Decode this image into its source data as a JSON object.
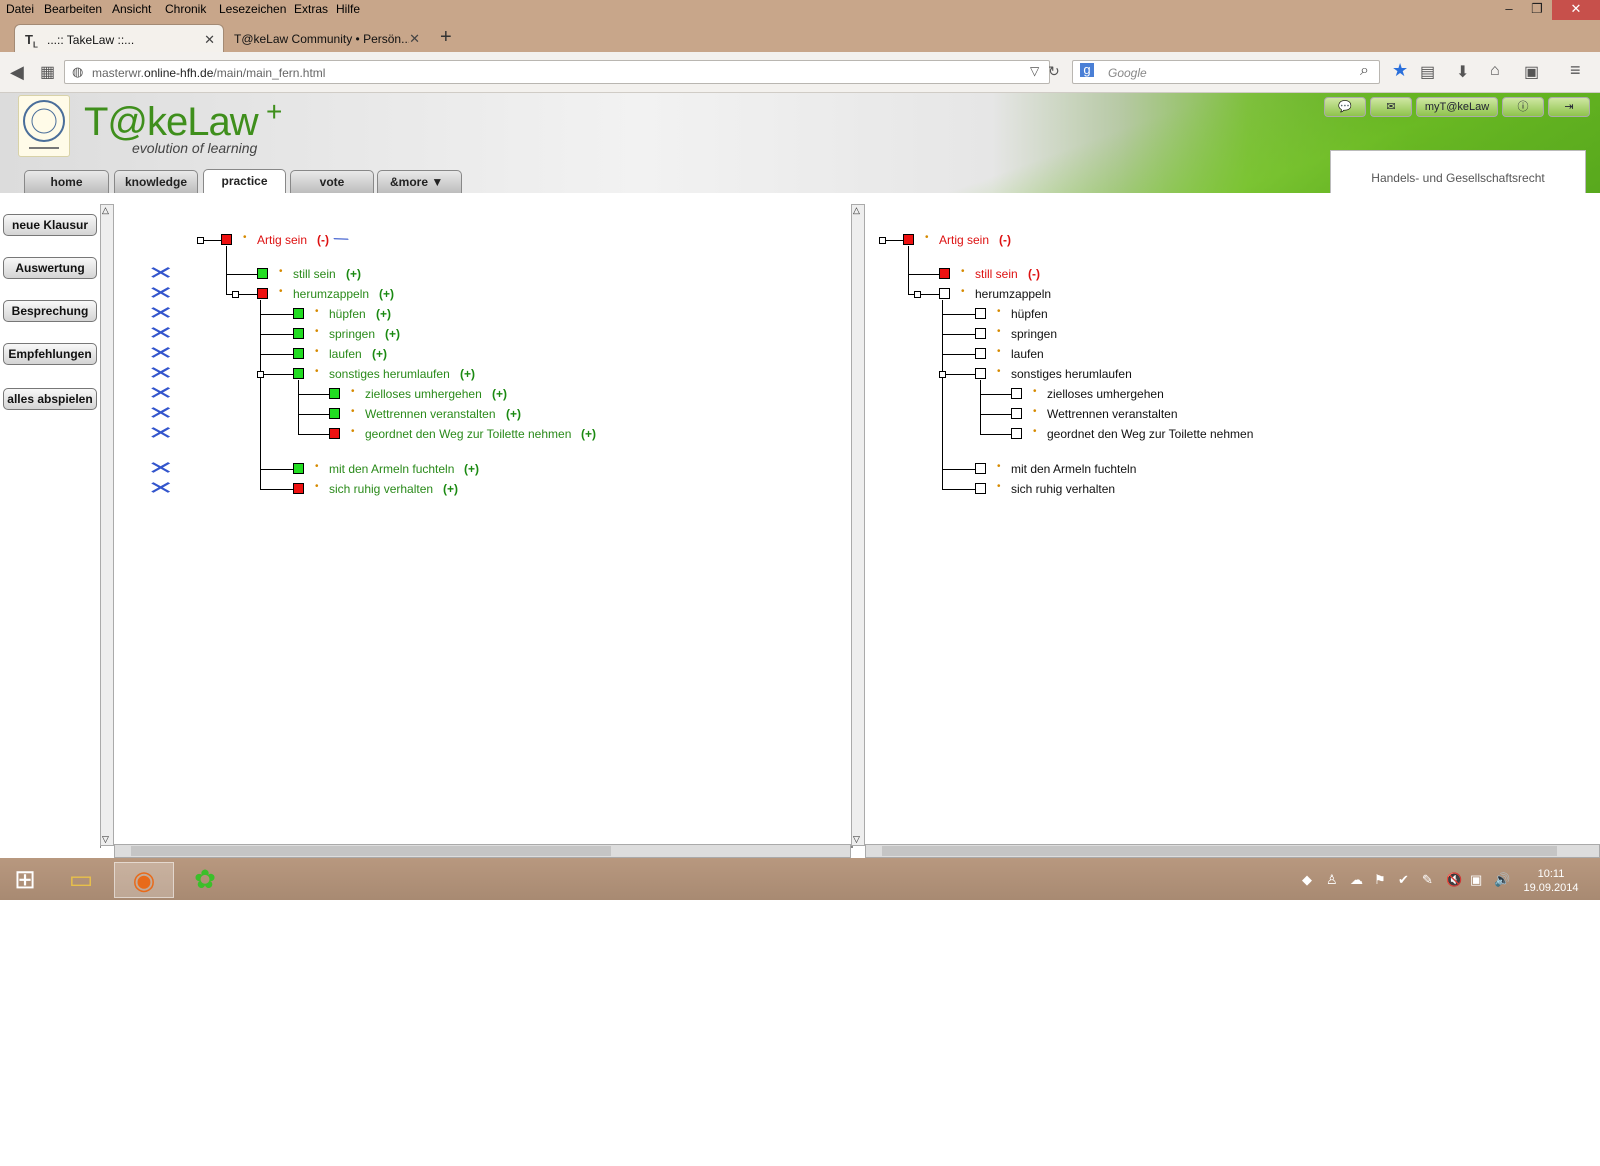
{
  "menu": [
    "Datei",
    "Bearbeiten",
    "Ansicht",
    "Chronik",
    "Lesezeichen",
    "Extras",
    "Hilfe"
  ],
  "tabs": [
    {
      "title": "...:: TakeLaw ::..."
    },
    {
      "title": "T@keLaw Community • Persön..."
    }
  ],
  "address": {
    "host_pre": "masterwr.",
    "host": "online-hfh.de",
    "path": "/main/main_fern.html"
  },
  "search": {
    "placeholder": "Google"
  },
  "site": {
    "logo": "T@keLaw",
    "logo_plus": "+",
    "slogan": "evolution of learning",
    "nav": [
      "home",
      "knowledge",
      "practice",
      "vote",
      "&more"
    ],
    "active_nav": "practice",
    "header_buttons": [
      "myT@keLaw"
    ],
    "course": "Handels- und Gesellschaftsrecht"
  },
  "sidebar": [
    "neue Klausur",
    "Auswertung",
    "Besprechung",
    "Empfehlungen",
    "alles abspielen"
  ],
  "tree_left": [
    {
      "label": "Artig sein",
      "mark": "(-)",
      "box": "red",
      "label_color": "red",
      "mark_color": "red"
    },
    {
      "label": "still sein",
      "mark": "(+)",
      "box": "green",
      "label_color": "green",
      "mark_color": "green"
    },
    {
      "label": "herumzappeln",
      "mark": "(+)",
      "box": "red",
      "label_color": "green",
      "mark_color": "green"
    },
    {
      "label": "hüpfen",
      "mark": "(+)",
      "box": "green",
      "label_color": "green",
      "mark_color": "green"
    },
    {
      "label": "springen",
      "mark": "(+)",
      "box": "green",
      "label_color": "green",
      "mark_color": "green"
    },
    {
      "label": "laufen",
      "mark": "(+)",
      "box": "green",
      "label_color": "green",
      "mark_color": "green"
    },
    {
      "label": "sonstiges herumlaufen",
      "mark": "(+)",
      "box": "green",
      "label_color": "green",
      "mark_color": "green"
    },
    {
      "label": "zielloses umhergehen",
      "mark": "(+)",
      "box": "green",
      "label_color": "green",
      "mark_color": "green"
    },
    {
      "label": "Wettrennen veranstalten",
      "mark": "(+)",
      "box": "green",
      "label_color": "green",
      "mark_color": "green"
    },
    {
      "label": "geordnet den Weg zur Toilette nehmen",
      "mark": "(+)",
      "box": "red",
      "label_color": "green",
      "mark_color": "green"
    },
    {
      "label": "mit den Armeln fuchteln",
      "mark": "(+)",
      "box": "green",
      "label_color": "green",
      "mark_color": "green"
    },
    {
      "label": "sich ruhig verhalten",
      "mark": "(+)",
      "box": "red",
      "label_color": "green",
      "mark_color": "green"
    }
  ],
  "tree_right": [
    {
      "label": "Artig sein",
      "mark": "(-)",
      "box": "red",
      "label_color": "red",
      "mark_color": "red"
    },
    {
      "label": "still sein",
      "mark": "(-)",
      "box": "red",
      "label_color": "red",
      "mark_color": "red"
    },
    {
      "label": "herumzappeln",
      "mark": "",
      "box": "white",
      "label_color": "black",
      "mark_color": "black"
    },
    {
      "label": "hüpfen",
      "mark": "",
      "box": "white",
      "label_color": "black",
      "mark_color": "black"
    },
    {
      "label": "springen",
      "mark": "",
      "box": "white",
      "label_color": "black",
      "mark_color": "black"
    },
    {
      "label": "laufen",
      "mark": "",
      "box": "white",
      "label_color": "black",
      "mark_color": "black"
    },
    {
      "label": "sonstiges herumlaufen",
      "mark": "",
      "box": "white",
      "label_color": "black",
      "mark_color": "black"
    },
    {
      "label": "zielloses umhergehen",
      "mark": "",
      "box": "white",
      "label_color": "black",
      "mark_color": "black"
    },
    {
      "label": "Wettrennen veranstalten",
      "mark": "",
      "box": "white",
      "label_color": "black",
      "mark_color": "black"
    },
    {
      "label": "geordnet den Weg zur Toilette nehmen",
      "mark": "",
      "box": "white",
      "label_color": "black",
      "mark_color": "black"
    },
    {
      "label": "mit den Armeln fuchteln",
      "mark": "",
      "box": "white",
      "label_color": "black",
      "mark_color": "black"
    },
    {
      "label": "sich ruhig verhalten",
      "mark": "",
      "box": "white",
      "label_color": "black",
      "mark_color": "black"
    }
  ],
  "taskbar": {
    "time": "10:11",
    "date": "19.09.2014"
  },
  "colors": {
    "green_box": "#22dd22",
    "red_box": "#ee1111",
    "green_text": "#2a8a1a",
    "red_text": "#dd1111",
    "pencil": "#3355cc"
  }
}
